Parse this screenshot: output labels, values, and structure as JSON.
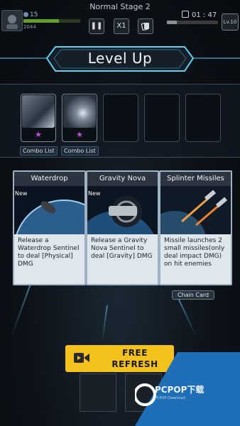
{
  "hud": {
    "shield_value": "15",
    "hp_text": "2044",
    "hp_fraction": 0.62,
    "stage_title": "Normal Stage 2",
    "pause_icon": "pause-icon",
    "speed_label": "X1",
    "card_icon": "cards-icon",
    "timer": "01 : 47",
    "xp_fraction": 0.2,
    "level": "Lv.10"
  },
  "banner": {
    "title": "Level Up",
    "accent": "#5fd0f0"
  },
  "combo": {
    "slots": [
      {
        "filled": true,
        "label": "Combo List",
        "star": "★"
      },
      {
        "filled": true,
        "label": "Combo List",
        "star": "★"
      },
      {
        "filled": false
      },
      {
        "filled": false
      },
      {
        "filled": false
      }
    ]
  },
  "cards": [
    {
      "title": "Waterdrop",
      "badge": "New",
      "description": "Release a Waterdrop Sentinel to deal [Physical] DMG"
    },
    {
      "title": "Gravity Nova",
      "badge": "New",
      "description": "Release a Gravity Nova Sentinel to deal [Gravity] DMG"
    },
    {
      "title": "Splinter Missiles",
      "badge": "",
      "description": "Missile launches 2 small missiles(only deal impact DMG) on hit enemies"
    }
  ],
  "chain_card_label": "Chain Card",
  "refresh": {
    "line1": "FREE",
    "line2": "REFRESH",
    "icon": "video-camera-icon",
    "color": "#f4c21c"
  },
  "watermark": {
    "text": "PCPOP下载",
    "sub": "PCPOP Download"
  }
}
